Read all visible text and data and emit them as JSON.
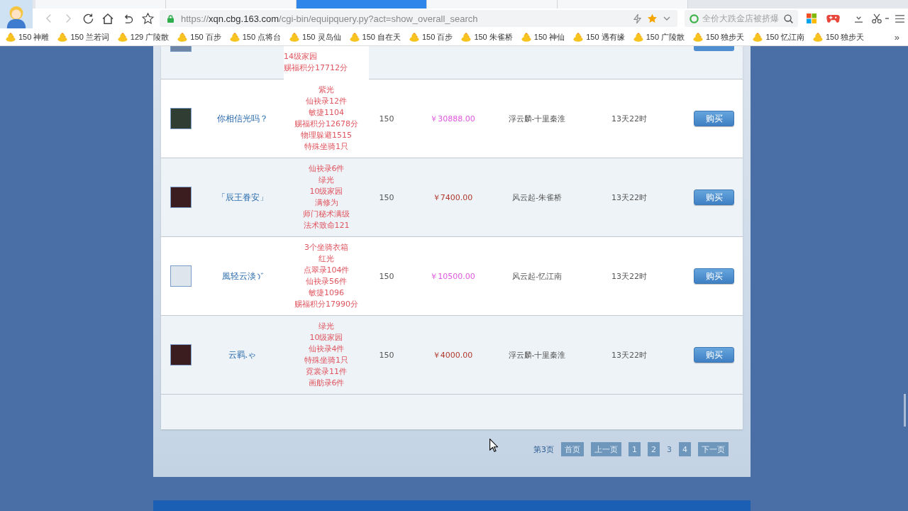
{
  "browser": {
    "tabs": [
      {
        "selected": false
      },
      {
        "selected": false
      },
      {
        "selected": true
      },
      {
        "selected": false
      },
      {
        "selected": false
      }
    ],
    "address": "https://**xqn.cbg.163.com**/cgi-bin/equipquery.py?act=show_overall_search",
    "search": {
      "placeholder": "全价大跌金店被挤爆"
    },
    "bookmarks": [
      "150 神雕",
      "150 兰若词",
      "129 广陵散",
      "150 百步",
      "150 点将台",
      "150 灵岛仙",
      "150 自在天",
      "150 百步",
      "150 朱雀桥",
      "150 神仙",
      "150 遇有缘",
      "150 广陵散",
      "150 独步天",
      "150 忆江南",
      "150 独步天"
    ],
    "bookmarks_more": "»"
  },
  "listing": {
    "partial_row": {
      "details": [
        "14级家园",
        "赐福积分17712分"
      ]
    },
    "rows": [
      {
        "name": "你相信光吗？",
        "name_icon": false,
        "details": [
          "紫光",
          "仙袂录12件",
          "敏捷1104",
          "赐福积分12678分",
          "物理躲避1515",
          "特殊坐骑1只"
        ],
        "char_level": "150",
        "price": {
          "text": "￥30888.00",
          "color": "#e055e0"
        },
        "server": "浮云麟-十里秦淮",
        "time_left": "13天22时",
        "button": "购买"
      },
      {
        "name": "「辰王眷安」",
        "name_icon": false,
        "details": [
          "仙袂录6件",
          "绿光",
          "10级家园",
          "满修为",
          "师门秘术满级",
          "法术致命121"
        ],
        "char_level": "150",
        "price": {
          "text": "￥7400.00",
          "color": "#b0382c"
        },
        "server": "风云起-朱雀桥",
        "time_left": "13天22时",
        "button": "购买"
      },
      {
        "name": "風轻云淡",
        "name_icon": true,
        "details": [
          "3个坐骑衣箱",
          "红光",
          "点翠录104件",
          "仙袂录56件",
          "敏捷1096",
          "赐福积分17990分"
        ],
        "char_level": "150",
        "price": {
          "text": "￥10500.00",
          "color": "#e055e0"
        },
        "server": "风云起-忆江南",
        "time_left": "13天22时",
        "button": "购买"
      },
      {
        "name": "云羁.ゃ",
        "name_icon": false,
        "details": [
          "绿光",
          "10级家园",
          "仙袂录4件",
          "特殊坐骑1只",
          "霓裳录11件",
          "画舫录6件"
        ],
        "char_level": "150",
        "price": {
          "text": "￥4000.00",
          "color": "#b0382c"
        },
        "server": "浮云麟-十里秦淮",
        "time_left": "13天22时",
        "button": "购买"
      }
    ]
  },
  "pagination": {
    "current_label": "第3页",
    "pages": [
      {
        "label": "首页",
        "selected": false
      },
      {
        "label": "上一页",
        "selected": false
      },
      {
        "label": "1",
        "selected": false
      },
      {
        "label": "2",
        "selected": false
      },
      {
        "label": "3",
        "selected": true
      },
      {
        "label": "4",
        "selected": false
      },
      {
        "label": "下一页",
        "selected": false
      }
    ]
  }
}
